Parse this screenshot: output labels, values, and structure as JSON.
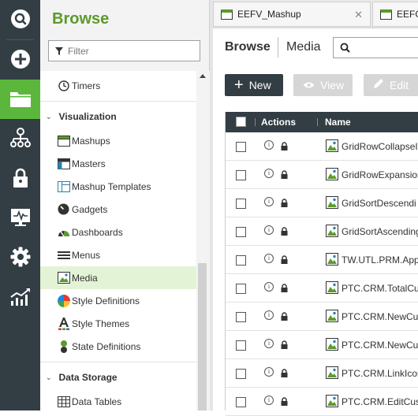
{
  "rail": {
    "items": [
      {
        "name": "search",
        "icon": "search-icon"
      },
      {
        "name": "new",
        "icon": "plus-circle-icon"
      },
      {
        "name": "browse",
        "icon": "folder-icon",
        "active": true
      },
      {
        "name": "modeler",
        "icon": "hierarchy-icon"
      },
      {
        "name": "security",
        "icon": "lock-icon"
      },
      {
        "name": "monitoring",
        "icon": "monitor-icon"
      },
      {
        "name": "settings",
        "icon": "gear-icon"
      },
      {
        "name": "analytics",
        "icon": "chart-icon"
      }
    ],
    "accent_color": "#5bb73b",
    "background_color": "#333d44"
  },
  "browse": {
    "title": "Browse",
    "filter_placeholder": "Filter",
    "timers": "Timers",
    "visualization": {
      "label": "Visualization",
      "items": [
        {
          "label": "Mashups",
          "icon": "mashup-icon"
        },
        {
          "label": "Masters",
          "icon": "master-icon"
        },
        {
          "label": "Mashup Templates",
          "icon": "template-icon"
        },
        {
          "label": "Gadgets",
          "icon": "gadget-icon"
        },
        {
          "label": "Dashboards",
          "icon": "dashboard-icon"
        },
        {
          "label": "Menus",
          "icon": "menu-icon"
        },
        {
          "label": "Media",
          "icon": "media-icon",
          "selected": true
        },
        {
          "label": "Style Definitions",
          "icon": "style-definition-icon"
        },
        {
          "label": "Style Themes",
          "icon": "style-theme-icon"
        },
        {
          "label": "State Definitions",
          "icon": "state-definition-icon"
        }
      ]
    },
    "data_storage": {
      "label": "Data Storage",
      "items": [
        {
          "label": "Data Tables",
          "icon": "table-icon"
        }
      ]
    }
  },
  "tabs": [
    {
      "label": "EEFV_Mashup",
      "active": true
    },
    {
      "label": "EEFG",
      "active": false
    }
  ],
  "main": {
    "breadcrumb": "Browse",
    "section": "Media",
    "buttons": {
      "new": "New",
      "view": "View",
      "edit": "Edit"
    },
    "columns": {
      "actions": "Actions",
      "name": "Name"
    },
    "rows": [
      "GridRowCollapseI",
      "GridRowExpansion",
      "GridSortDescendi",
      "GridSortAscending",
      "TW.UTL.PRM.App",
      "PTC.CRM.TotalCu",
      "PTC.CRM.NewCu",
      "PTC.CRM.NewCu",
      "PTC.CRM.LinkIcon",
      "PTC.CRM.EditCus"
    ]
  }
}
